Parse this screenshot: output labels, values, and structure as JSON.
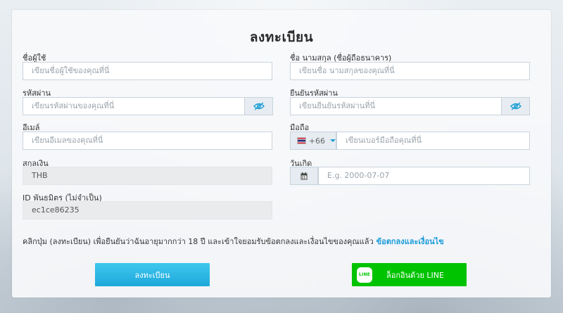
{
  "form": {
    "title": "ลงทะเบียน",
    "username": {
      "label": "ชื่อผู้ใช้",
      "placeholder": "เขียนชื่อผู้ใช้ของคุณที่นี่"
    },
    "fullname": {
      "label": "ชื่อ นามสกุล (ชื่อผู้ถือธนาคาร)",
      "placeholder": "เขียนชื่อ นามสกุลของคุณที่นี่"
    },
    "password": {
      "label": "รหัสผ่าน",
      "placeholder": "เขียนรหัสผ่านของคุณที่นี่"
    },
    "confirm_password": {
      "label": "ยืนยันรหัสผ่าน",
      "placeholder": "เขียนยืนยันรหัสผ่านที่นี่"
    },
    "email": {
      "label": "อีเมล์",
      "placeholder": "เขียนอีเมลของคุณที่นี่"
    },
    "phone": {
      "label": "มือถือ",
      "dial_code": "+66",
      "placeholder": "เขียนเบอร์มือถือคุณที่นี่"
    },
    "currency": {
      "label": "สกุลเงิน",
      "value": "THB"
    },
    "birthdate": {
      "label": "วันเกิด",
      "placeholder": "E.g. 2000-07-07"
    },
    "partner_id": {
      "label": "ID พันธมิตร (ไม่จำเป็น)",
      "value": "ec1ce86235"
    },
    "consent": {
      "text": "คลิกปุ่ม (ลงทะเบียน) เพื่อยืนยันว่าฉันอายุมากกว่า 18 ปี และเข้าใจยอมรับข้อตกลงและเงื่อนไขของคุณแล้ว",
      "link": "ข้อตกลงและเงื่อนไข"
    },
    "register_button": "ลงทะเบียน",
    "line_button": "ล็อกอินด้วย LINE",
    "line_logo_text": "LINE"
  },
  "colors": {
    "accent": "#1ea8da",
    "line_green": "#00c300",
    "link": "#1a9bd8"
  },
  "icons": {
    "password_toggle": "eye-slash-icon",
    "calendar": "calendar-icon",
    "flag": "thailand-flag-icon",
    "dropdown": "caret-down-icon",
    "line": "line-logo-icon"
  }
}
